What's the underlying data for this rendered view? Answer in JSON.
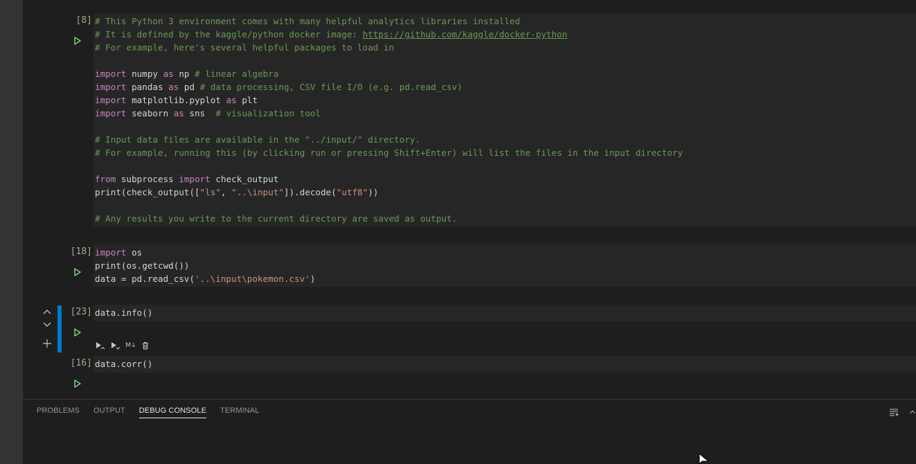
{
  "cells": [
    {
      "exec_count": "[8]",
      "lines": [
        [
          [
            "cm",
            "# This Python 3 environment comes with many helpful analytics libraries installed"
          ]
        ],
        [
          [
            "cm",
            "# It is defined by the kaggle/python docker image: "
          ],
          [
            "lnk",
            "https://github.com/kaggle/docker-python"
          ]
        ],
        [
          [
            "cm",
            "# For example, here's several helpful packages to load in"
          ]
        ],
        [],
        [
          [
            "kw",
            "import"
          ],
          [
            "fn",
            " numpy "
          ],
          [
            "kw",
            "as"
          ],
          [
            "fn",
            " np "
          ],
          [
            "cm",
            "# linear algebra"
          ]
        ],
        [
          [
            "kw",
            "import"
          ],
          [
            "fn",
            " pandas "
          ],
          [
            "kw",
            "as"
          ],
          [
            "fn",
            " pd "
          ],
          [
            "cm",
            "# data processing, CSV file I/O (e.g. pd.read_csv)"
          ]
        ],
        [
          [
            "kw",
            "import"
          ],
          [
            "fn",
            " matplotlib.pyplot "
          ],
          [
            "kw",
            "as"
          ],
          [
            "fn",
            " plt"
          ]
        ],
        [
          [
            "kw",
            "import"
          ],
          [
            "fn",
            " seaborn "
          ],
          [
            "kw",
            "as"
          ],
          [
            "fn",
            " sns  "
          ],
          [
            "cm",
            "# visualization tool"
          ]
        ],
        [],
        [
          [
            "cm",
            "# Input data files are available in the \"../input/\" directory."
          ]
        ],
        [
          [
            "cm",
            "# For example, running this (by clicking run or pressing Shift+Enter) will list the files in the input directory"
          ]
        ],
        [],
        [
          [
            "kw",
            "from"
          ],
          [
            "fn",
            " subprocess "
          ],
          [
            "kw",
            "import"
          ],
          [
            "fn",
            " check_output"
          ]
        ],
        [
          [
            "fn",
            "print(check_output(["
          ],
          [
            "str",
            "\"ls\""
          ],
          [
            "fn",
            ", "
          ],
          [
            "str",
            "\"..\\input\""
          ],
          [
            "fn",
            "]).decode("
          ],
          [
            "str",
            "\"utf8\""
          ],
          [
            "fn",
            "))"
          ]
        ],
        [],
        [
          [
            "cm",
            "# Any results you write to the current directory are saved as output."
          ]
        ]
      ]
    },
    {
      "exec_count": "[18]",
      "lines": [
        [
          [
            "kw",
            "import"
          ],
          [
            "fn",
            " os"
          ]
        ],
        [
          [
            "fn",
            "print(os.getcwd())"
          ]
        ],
        [
          [
            "fn",
            "data = pd.read_csv("
          ],
          [
            "str",
            "'..\\input\\pokemon.csv'"
          ],
          [
            "fn",
            ")"
          ]
        ]
      ]
    },
    {
      "exec_count": "[23]",
      "lines": [
        [
          [
            "fn",
            "data.info()"
          ]
        ]
      ]
    },
    {
      "exec_count": "[16]",
      "lines": [
        [
          [
            "fn",
            "data.corr()"
          ]
        ]
      ]
    }
  ],
  "cell_toolbar": {
    "markdown_label": "M↓"
  },
  "panel": {
    "tabs": [
      {
        "label": "PROBLEMS",
        "active": false
      },
      {
        "label": "OUTPUT",
        "active": false
      },
      {
        "label": "DEBUG CONSOLE",
        "active": true
      },
      {
        "label": "TERMINAL",
        "active": false
      }
    ]
  },
  "icons": {
    "run": "run-cell-icon",
    "move_up": "chevron-up-icon",
    "move_down": "chevron-down-icon",
    "add": "plus-icon",
    "run_above": "run-above-icon",
    "run_below": "run-below-icon",
    "delete": "trash-icon",
    "clear": "clear-console-icon",
    "maximize": "chevron-up-icon"
  },
  "colors": {
    "accent": "#007acc",
    "run_icon": "#89d185",
    "keyword": "#c586c0",
    "comment": "#6a9955",
    "string": "#ce9178"
  }
}
